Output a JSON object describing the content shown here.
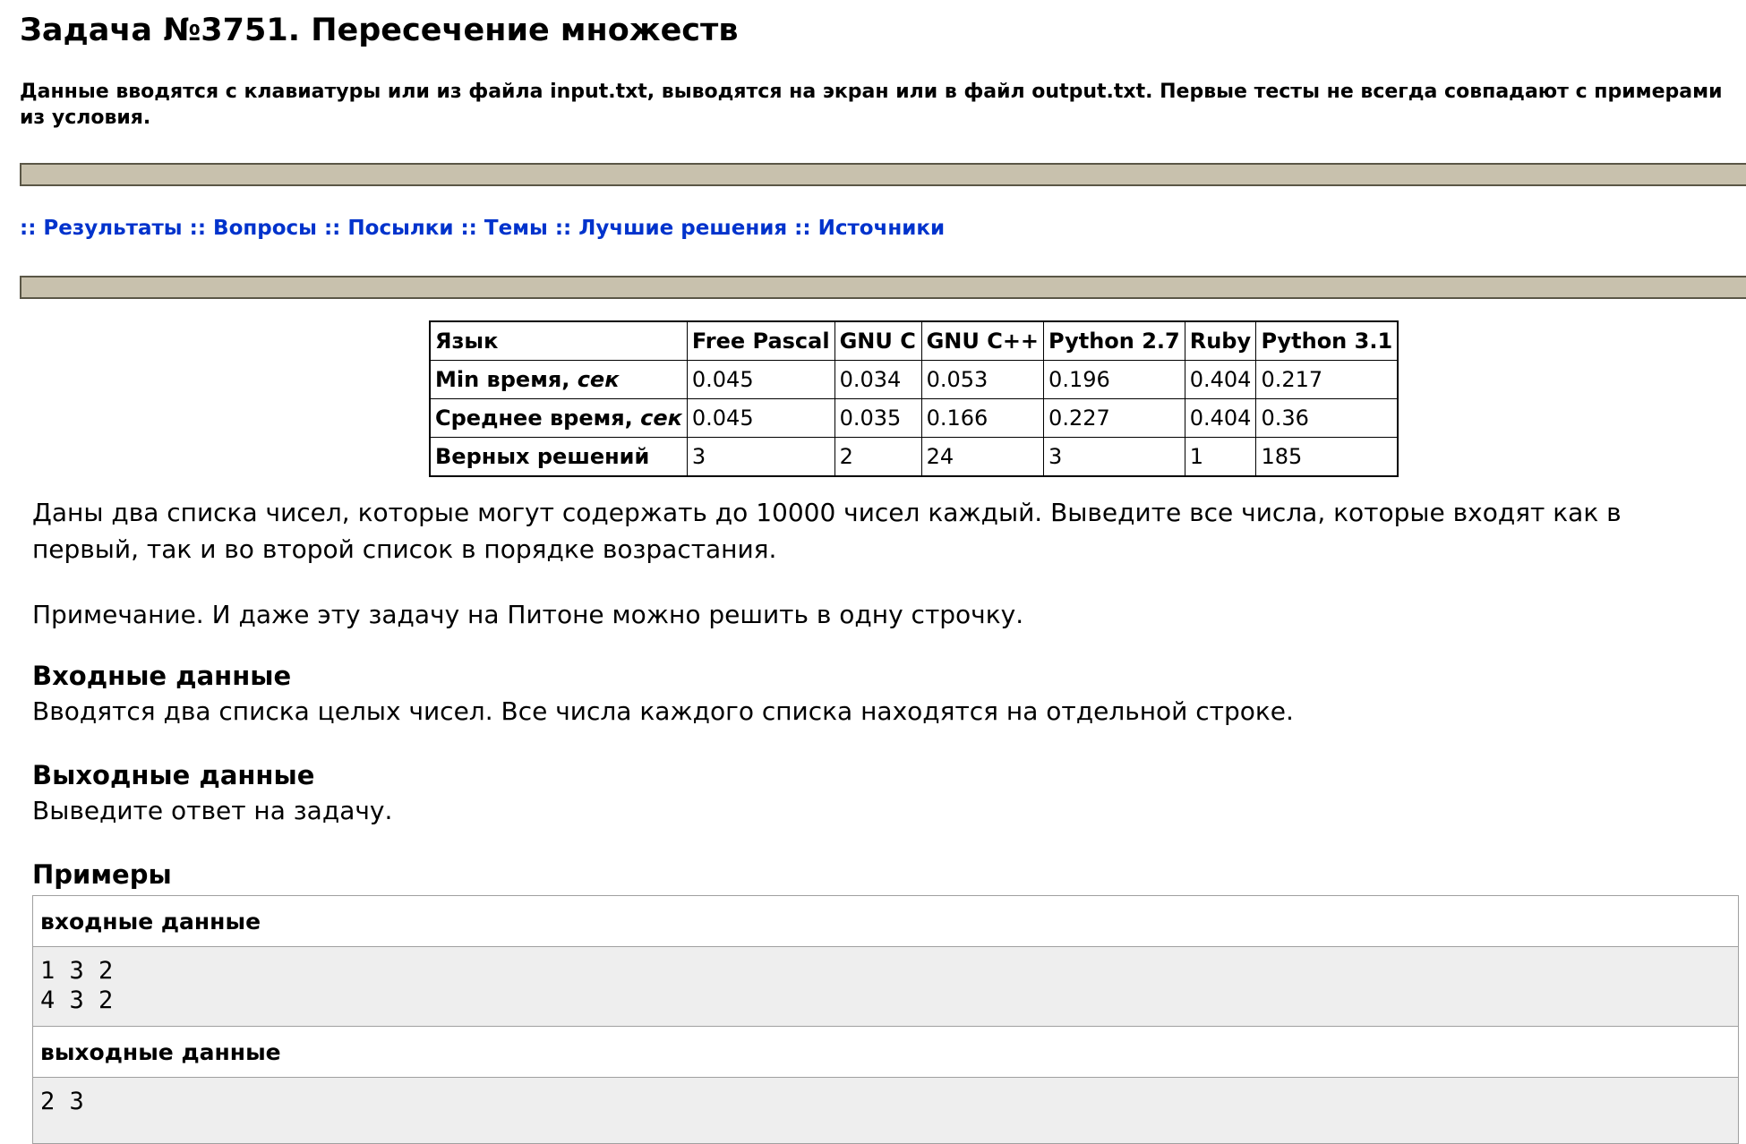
{
  "title": "Задача №3751. Пересечение множеств",
  "notice": "Данные вводятся с клавиатуры или из файла input.txt, выводятся на экран или в файл output.txt. Первые тесты не всегда совпадают с примерами из условия.",
  "nav": {
    "separator": "::",
    "links": [
      "Результаты",
      "Вопросы",
      "Посылки",
      "Темы",
      "Лучшие решения",
      "Источники"
    ]
  },
  "stats": {
    "header": [
      "Язык",
      "Free Pascal",
      "GNU C",
      "GNU C++",
      "Python 2.7",
      "Ruby",
      "Python 3.1"
    ],
    "rows": [
      {
        "label": "Min время,",
        "unit": "сек",
        "values": [
          "0.045",
          "0.034",
          "0.053",
          "0.196",
          "0.404",
          "0.217"
        ]
      },
      {
        "label": "Среднее время,",
        "unit": "сек",
        "values": [
          "0.045",
          "0.035",
          "0.166",
          "0.227",
          "0.404",
          "0.36"
        ]
      },
      {
        "label": "Верных решений",
        "unit": "",
        "values": [
          "3",
          "2",
          "24",
          "3",
          "1",
          "185"
        ]
      }
    ]
  },
  "statement": "Даны два списка чисел, которые могут содержать до 10000 чисел каждый. Выведите все числа, которые входят как в первый, так и во второй список в порядке возрастания.",
  "note": "Примечание. И даже эту задачу на Питоне можно решить в одну строчку.",
  "input_section": {
    "heading": "Входные данные",
    "text": "Вводятся два списка целых чисел. Все числа каждого списка находятся на отдельной строке."
  },
  "output_section": {
    "heading": "Выходные данные",
    "text": "Выведите ответ на задачу."
  },
  "examples": {
    "heading": "Примеры",
    "input_label": "входные данные",
    "input_lines": [
      "1 3 2",
      "4 3 2"
    ],
    "output_label": "выходные данные",
    "output_lines": [
      "2 3"
    ]
  }
}
